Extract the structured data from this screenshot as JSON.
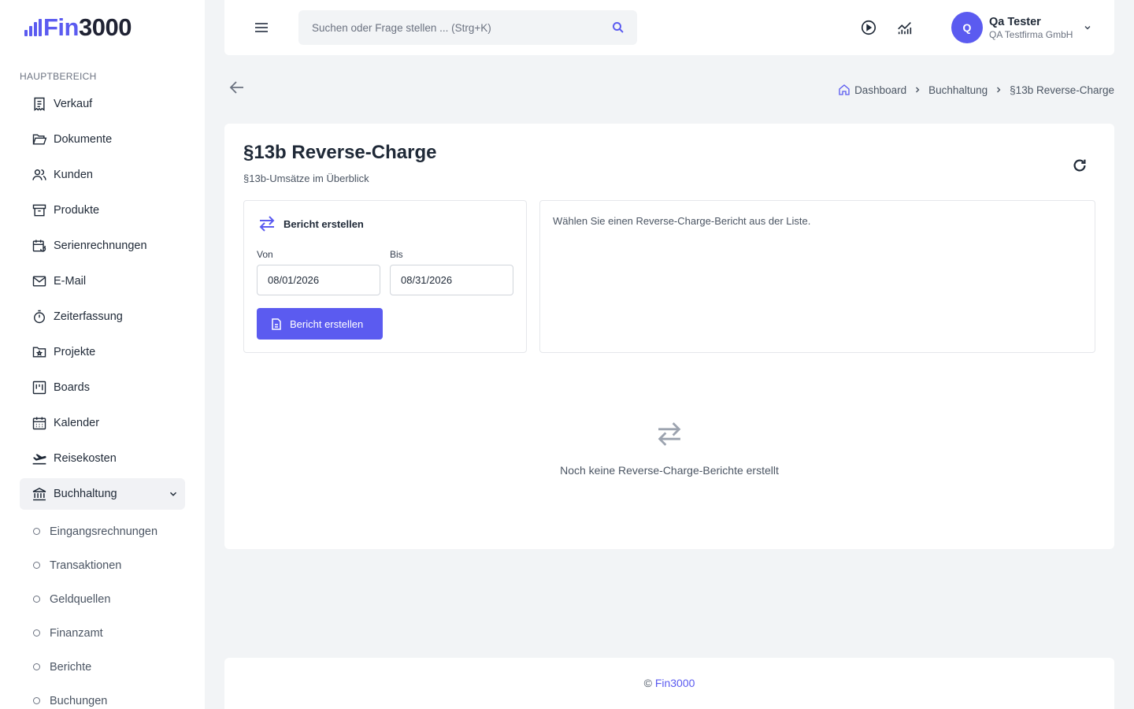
{
  "brand": {
    "logo_fin": "Fin",
    "logo_num": "3000",
    "accent_color": "#5b5bf0"
  },
  "sidebar": {
    "section_label": "HAUPTBEREICH",
    "items": [
      {
        "label": "Verkauf",
        "icon": "receipt-icon"
      },
      {
        "label": "Dokumente",
        "icon": "folder-open-icon"
      },
      {
        "label": "Kunden",
        "icon": "users-icon"
      },
      {
        "label": "Produkte",
        "icon": "archive-icon"
      },
      {
        "label": "Serienrechnungen",
        "icon": "calendar-repeat-icon"
      },
      {
        "label": "E-Mail",
        "icon": "mail-icon"
      },
      {
        "label": "Zeiterfassung",
        "icon": "stopwatch-icon"
      },
      {
        "label": "Projekte",
        "icon": "folder-star-icon"
      },
      {
        "label": "Boards",
        "icon": "kanban-icon"
      },
      {
        "label": "Kalender",
        "icon": "calendar-icon"
      },
      {
        "label": "Reisekosten",
        "icon": "plane-icon"
      },
      {
        "label": "Buchhaltung",
        "icon": "bank-icon",
        "active": true,
        "expanded": true
      }
    ],
    "sub_items": [
      {
        "label": "Eingangsrechnungen"
      },
      {
        "label": "Transaktionen"
      },
      {
        "label": "Geldquellen"
      },
      {
        "label": "Finanzamt"
      },
      {
        "label": "Berichte"
      },
      {
        "label": "Buchungen"
      }
    ]
  },
  "topbar": {
    "search_placeholder": "Suchen oder Frage stellen ... (Strg+K)",
    "search_value": "",
    "user": {
      "initial": "Q",
      "name": "Qa Tester",
      "company": "QA Testfirma GmbH"
    }
  },
  "breadcrumb": {
    "items": [
      "Dashboard",
      "Buchhaltung",
      "§13b Reverse-Charge"
    ]
  },
  "page": {
    "title": "§13b Reverse-Charge",
    "subtitle": "§13b-Umsätze im Überblick",
    "create_panel": {
      "title": "Bericht erstellen",
      "from_label": "Von",
      "from_value": "08/01/2026",
      "to_label": "Bis",
      "to_value": "08/31/2026",
      "button_label": "Bericht erstellen"
    },
    "detail_hint": "Wählen Sie einen Reverse-Charge-Bericht aus der Liste.",
    "empty_text": "Noch keine Reverse-Charge-Berichte erstellt"
  },
  "footer": {
    "copyright": "©",
    "brand": "Fin3000"
  }
}
